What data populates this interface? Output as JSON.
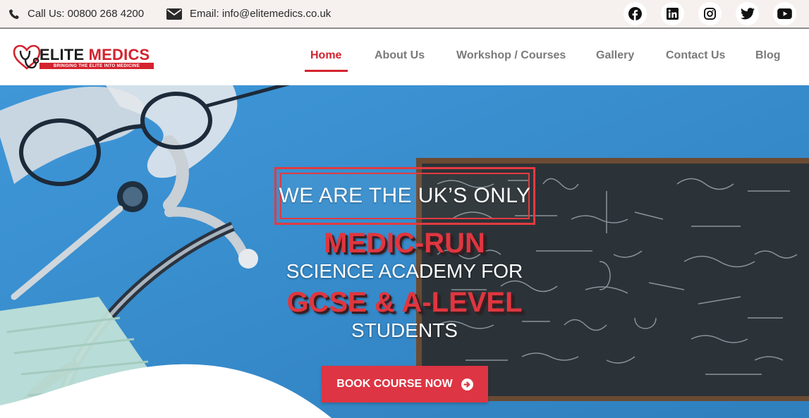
{
  "topbar": {
    "phone_text": "Call Us: 00800 268 4200",
    "email_text": "Email: info@elitemedics.co.uk",
    "icons": {
      "phone": "phone-icon",
      "email": "envelope-icon"
    },
    "socials": [
      "facebook-icon",
      "linkedin-icon",
      "instagram-icon",
      "twitter-icon",
      "youtube-icon"
    ]
  },
  "logo": {
    "title_part1": "ELITE",
    "title_part2": "MEDICS",
    "tagline": "BRINGING THE ELITE INTO MEDICINE",
    "icon": "heart-stethoscope-icon"
  },
  "nav": {
    "items": [
      {
        "label": "Home",
        "active": true
      },
      {
        "label": "About Us",
        "active": false
      },
      {
        "label": "Workshop / Courses",
        "active": false
      },
      {
        "label": "Gallery",
        "active": false
      },
      {
        "label": "Contact Us",
        "active": false
      },
      {
        "label": "Blog",
        "active": false
      }
    ]
  },
  "hero": {
    "boxed_text": "WE ARE THE UK’S ONLY",
    "line_red_1": "MEDIC-RUN",
    "line_white_1": "SCIENCE ACADEMY FOR",
    "line_red_2": "GCSE & A-LEVEL",
    "line_white_2": "STUDENTS",
    "cta_label": "BOOK COURSE NOW",
    "cta_icon": "arrow-circle-right-icon"
  },
  "colors": {
    "accent": "#d3232f",
    "topbar_bg": "#f6f1ef",
    "hero_bg": "#3a8fd0",
    "cta_bg": "#dd3543",
    "nav_text": "#7a7a7a"
  }
}
